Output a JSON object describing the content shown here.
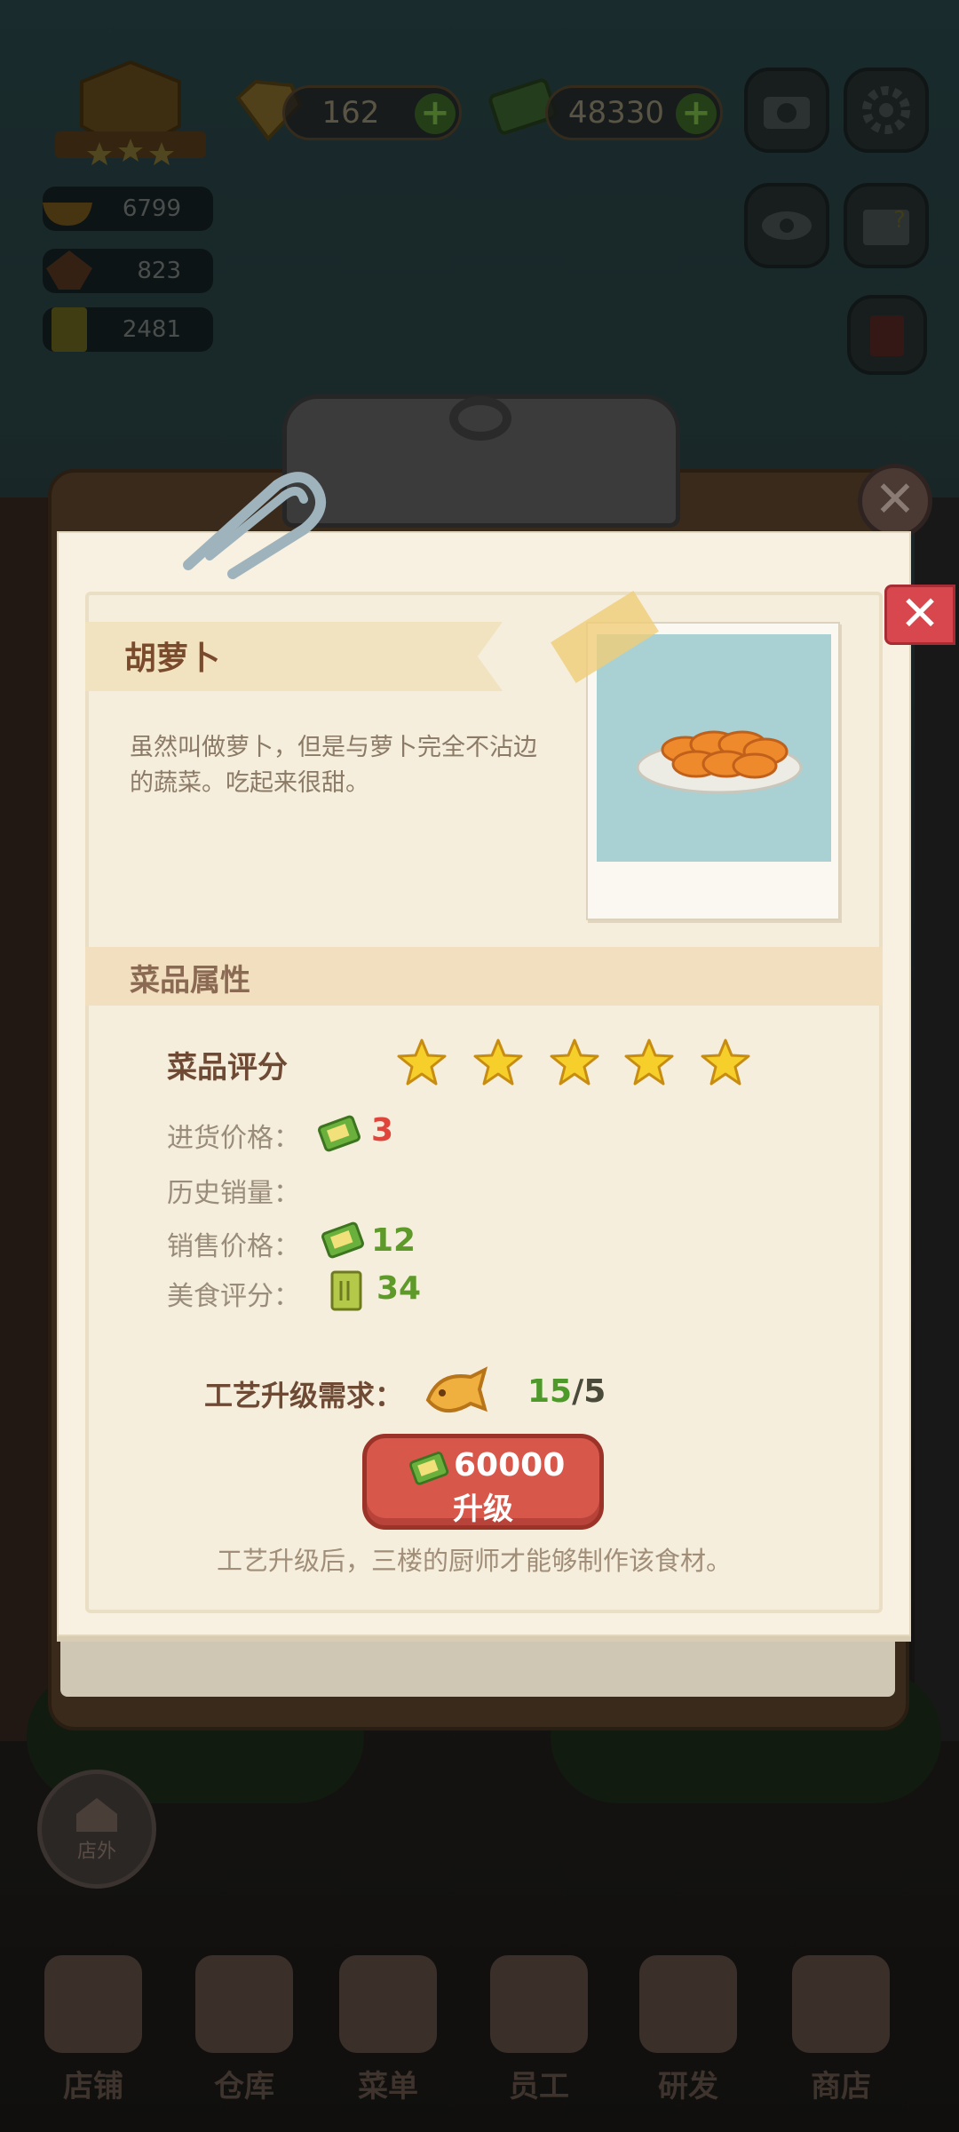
{
  "hud": {
    "diamonds": "162",
    "cash": "48330",
    "stat_food": "6799",
    "stat_chef": "823",
    "stat_book": "2481"
  },
  "dialog": {
    "item_name": "胡萝卜",
    "description": "虽然叫做萝卜，但是与萝卜完全不沾边的蔬菜。吃起来很甜。",
    "section_title": "菜品属性",
    "rating_label": "菜品评分",
    "rating_stars": 5,
    "purchase_price_label": "进货价格：",
    "purchase_price": "3",
    "history_sales_label": "历史销量：",
    "sale_price_label": "销售价格：",
    "sale_price": "12",
    "food_rating_label": "美食评分：",
    "food_rating": "34",
    "upgrade_req_label": "工艺升级需求：",
    "upgrade_have": "15",
    "upgrade_need": "/5",
    "upgrade_cost": "60000",
    "upgrade_button": "升级",
    "upgrade_note": "工艺升级后，三楼的厨师才能够制作该食材。",
    "close_glyph": "✕"
  },
  "nav": {
    "outside": "店外",
    "items": [
      "店铺",
      "仓库",
      "菜单",
      "员工",
      "研发",
      "商店"
    ]
  },
  "colors": {
    "price_red": "#e0453c",
    "price_green": "#5d9a2a",
    "upgrade_green": "#4d9a2a",
    "button_red": "#d7574b"
  }
}
